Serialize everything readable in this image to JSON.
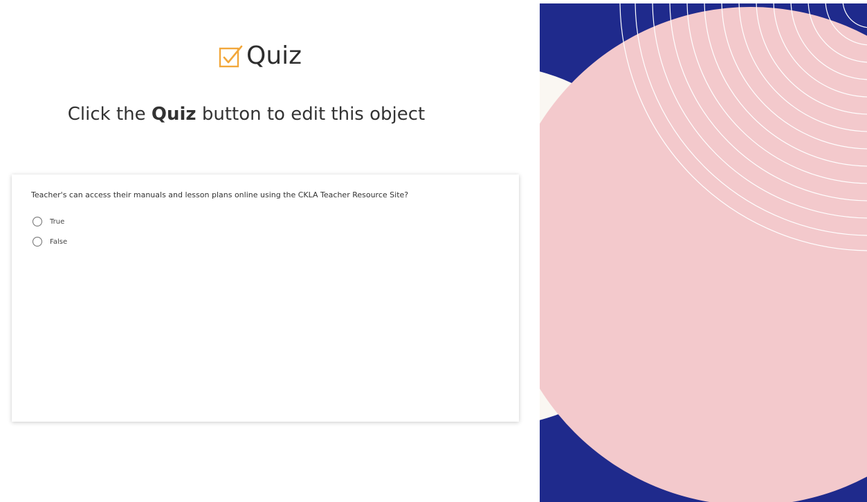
{
  "logo": {
    "text": "Quiz",
    "icon": "checkbox-check-icon",
    "icon_color": "#f2a73b"
  },
  "instruction": {
    "prefix": "Click the ",
    "bold": "Quiz",
    "suffix": " button to edit this object"
  },
  "quiz": {
    "question": "Teacher's can access their manuals and lesson plans online using the CKLA Teacher Resource Site?",
    "options": [
      {
        "label": "True",
        "selected": false
      },
      {
        "label": "False",
        "selected": false
      }
    ]
  },
  "decor": {
    "navy": "#1f2a8c",
    "cream": "#faf7f2",
    "pink": "#f3c9cc",
    "ring": "#ffffff"
  }
}
